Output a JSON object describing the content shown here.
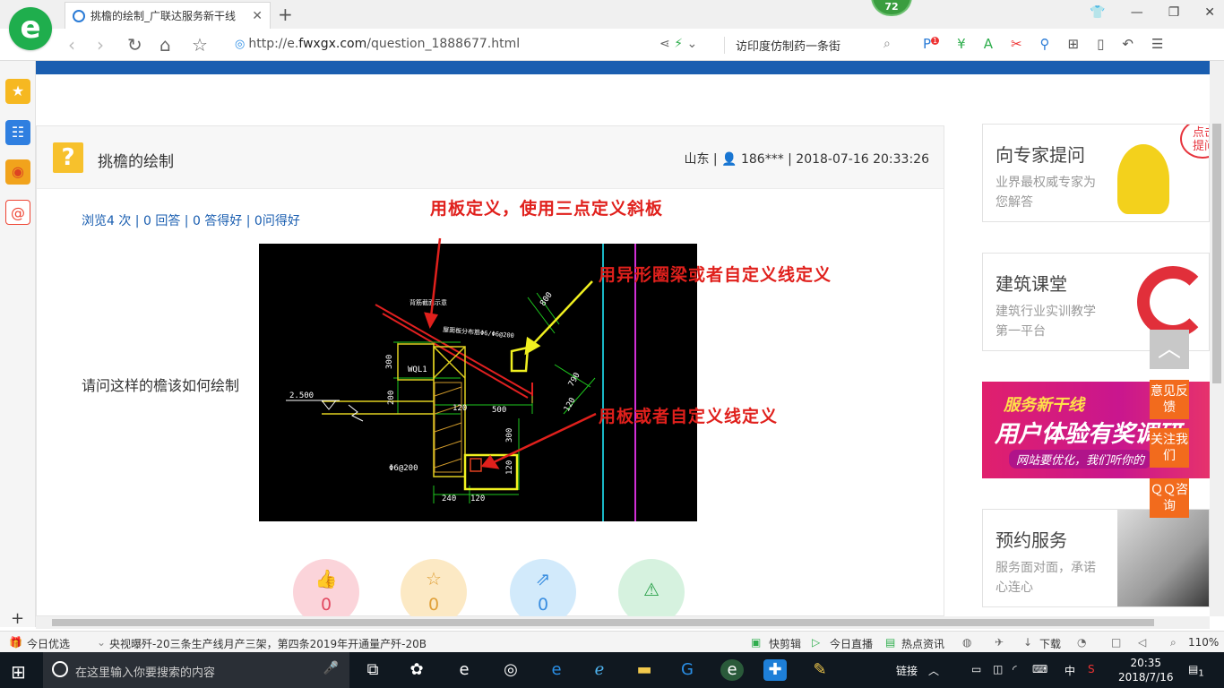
{
  "browser": {
    "tab_title": "挑檐的绘制_广联达服务新干线",
    "new_tab": "+",
    "badge_count": "72",
    "url_prefix": "http://e.",
    "url_domain": "fwxgx.com",
    "url_path": "/question_1888677.html",
    "search_placeholder": "访印度仿制药一条街",
    "extension_badge": "1"
  },
  "question": {
    "title": "挑檐的绘制",
    "meta": "山东 | 👤 186*** | 2018-07-16 20:33:26",
    "stats": "浏览4 次 | 0 回答 | 0 答得好 | 0问得好",
    "body": "请问这样的檐该如何绘制"
  },
  "annotations": {
    "a1": "用板定义，使用三点定义斜板",
    "a2": "用异形圈梁或者自定义线定义",
    "a3": "用板或者自定义线定义"
  },
  "cad": {
    "dim_800": "800",
    "dim_790": "790",
    "dim_120a": "120",
    "dim_500": "500",
    "dim_300a": "300",
    "dim_200": "200",
    "dim_300b": "300",
    "dim_120b": "120",
    "dim_240": "240",
    "dim_120c": "120",
    "wql": "WQL1",
    "phi_note": "Φ6@200",
    "level": "2.500",
    "note1": "背筋截面示意",
    "note2": "屋面板分布筋Φ6/Φ6@200"
  },
  "actions": {
    "like": "0",
    "star": "0",
    "share": "0"
  },
  "right": {
    "card1_title": "向专家提问",
    "card1_sub": "业界最权威专家为您解答",
    "card1_bubble": "点击提问",
    "card2_title": "建筑课堂",
    "card2_sub": "建筑行业实训教学第一平台",
    "banner_1": "服务新干线",
    "banner_2": "用户体验有奖调研",
    "banner_3": "网站要优化，我们听你的",
    "card3_title": "预约服务",
    "card3_sub": "服务面对面，承诺心连心"
  },
  "float": {
    "feedback": "意见反馈",
    "follow": "关注我们",
    "qq": "ＱＱ咨询"
  },
  "statusbar": {
    "today": "今日优选",
    "news": "央视曝歼-20三条生产线月产三架，第四条2019年开通量产歼-20B",
    "kuaijian": "快剪辑",
    "live": "今日直播",
    "hot": "热点资讯",
    "download": "下载",
    "zoom": "110%"
  },
  "taskbar": {
    "search": "在这里输入你要搜索的内容",
    "link": "链接",
    "lang": "中",
    "time": "20:35",
    "date": "2018/7/16",
    "notif": "1"
  },
  "colors": {
    "brand_blue": "#1a5eb0",
    "annot_red": "#e0201c",
    "float_orange": "#f26b1d"
  }
}
